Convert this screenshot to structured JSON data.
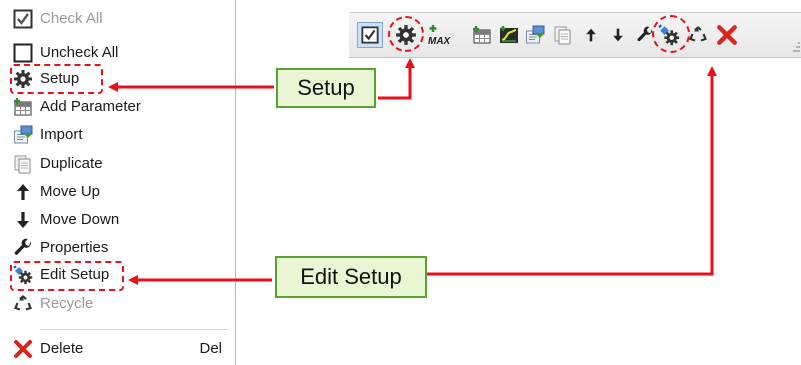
{
  "context_menu": {
    "items": [
      {
        "label": "Check All",
        "icon": "checkbox-checked-icon",
        "disabled": true
      },
      {
        "label": "Uncheck All",
        "icon": "checkbox-unchecked-icon",
        "disabled": false
      },
      {
        "label": "Setup",
        "icon": "gear-icon",
        "disabled": false
      },
      {
        "label": "Add Parameter",
        "icon": "add-parameter-icon",
        "disabled": false
      },
      {
        "label": "Import",
        "icon": "import-icon",
        "disabled": false
      },
      {
        "label": "Duplicate",
        "icon": "duplicate-icon",
        "disabled": false
      },
      {
        "label": "Move Up",
        "icon": "arrow-up-icon",
        "disabled": false
      },
      {
        "label": "Move Down",
        "icon": "arrow-down-icon",
        "disabled": false
      },
      {
        "label": "Properties",
        "icon": "wrench-icon",
        "disabled": false
      },
      {
        "label": "Edit Setup",
        "icon": "edit-setup-icon",
        "disabled": false
      },
      {
        "label": "Recycle",
        "icon": "recycle-icon",
        "disabled": true
      }
    ],
    "delete_item": {
      "label": "Delete",
      "shortcut": "Del",
      "icon": "delete-x-icon"
    }
  },
  "toolbar": {
    "buttons": [
      "checkbox-checked-icon",
      "gear-icon",
      "max-icon",
      "add-parameter-icon",
      "chart-icon",
      "import-icon",
      "duplicate-icon",
      "arrow-up-icon",
      "arrow-down-icon",
      "wrench-icon",
      "edit-setup-icon",
      "recycle-icon",
      "delete-x-icon"
    ],
    "max_text": "MAX"
  },
  "callouts": {
    "setup": "Setup",
    "edit_setup": "Edit Setup"
  },
  "colors": {
    "highlight_red": "#e8101a",
    "callout_fill": "#e9f6d3",
    "callout_border": "#5aa12f",
    "delete_red": "#d9261c"
  }
}
